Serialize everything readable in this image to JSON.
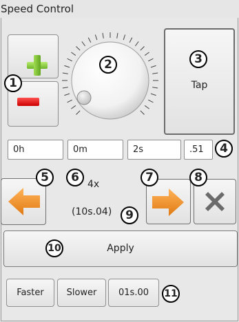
{
  "window": {
    "title": "Speed Control"
  },
  "controls": {
    "tap_label": "Tap",
    "hours_value": "0h",
    "minutes_value": "0m",
    "seconds_value": "2s",
    "fraction_value": ".51",
    "multiplier_text": "4x",
    "period_text": "(10s.04)",
    "apply_label": "Apply",
    "faster_label": "Faster",
    "slower_label": "Slower",
    "preset_label": "01s.00"
  },
  "annotations": [
    "1",
    "2",
    "3",
    "4",
    "5",
    "6",
    "7",
    "8",
    "9",
    "10",
    "11"
  ],
  "colors": {
    "accent_orange": "#f28c1f",
    "plus_green": "#7cc234",
    "minus_red": "#e01b1b"
  },
  "icons": [
    "plus-icon",
    "minus-icon",
    "knob-dial",
    "left-arrow-icon",
    "right-arrow-icon",
    "clear-x-icon"
  ]
}
